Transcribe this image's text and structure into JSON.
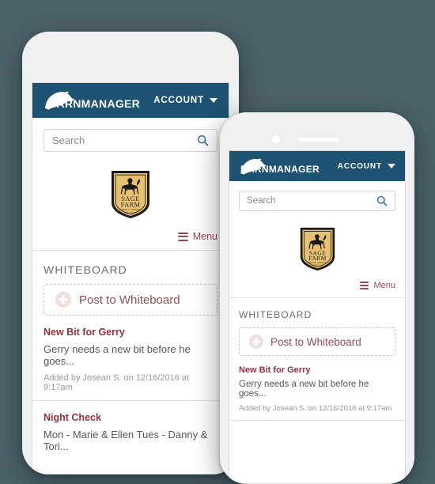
{
  "background_color": "#4c6269",
  "theme": {
    "navy": "#1d5273",
    "maroon": "#9a4a52",
    "post_title": "#9a2f3a",
    "crest_gold": "#e8c170",
    "search_icon": "#2b6ea8"
  },
  "app": {
    "logo_text_bold": "BARN",
    "logo_text_light": "MANAGER",
    "logo_icon": "horse-head-icon",
    "account_label": "ACCOUNT",
    "account_caret_icon": "caret-down-icon",
    "search": {
      "placeholder": "Search",
      "value": "",
      "icon": "search-icon"
    },
    "farm_logo": {
      "name": "sage-farm-crest",
      "line1": "SAGE",
      "line2": "FARM",
      "line3": "RIDING SCHOOL",
      "line4": "BOSTON  MA"
    },
    "menu": {
      "label": "Menu",
      "icon": "hamburger-icon"
    },
    "whiteboard": {
      "section_title": "WHITEBOARD",
      "post_button_label": "Post to Whiteboard",
      "post_button_icon": "plus-circle-icon",
      "posts": [
        {
          "title": "New Bit for Gerry",
          "body": "Gerry needs a new bit before he goes...",
          "meta": "Added by Josean S. on 12/16/2016 at 9:17am"
        },
        {
          "title": "Night Check",
          "body": "Mon - Marie & Ellen Tues - Danny & Tori...",
          "meta": ""
        }
      ]
    }
  },
  "devices": [
    {
      "name": "back-phone",
      "label": "Large phone mockup"
    },
    {
      "name": "front-phone",
      "label": "Small phone mockup"
    }
  ]
}
